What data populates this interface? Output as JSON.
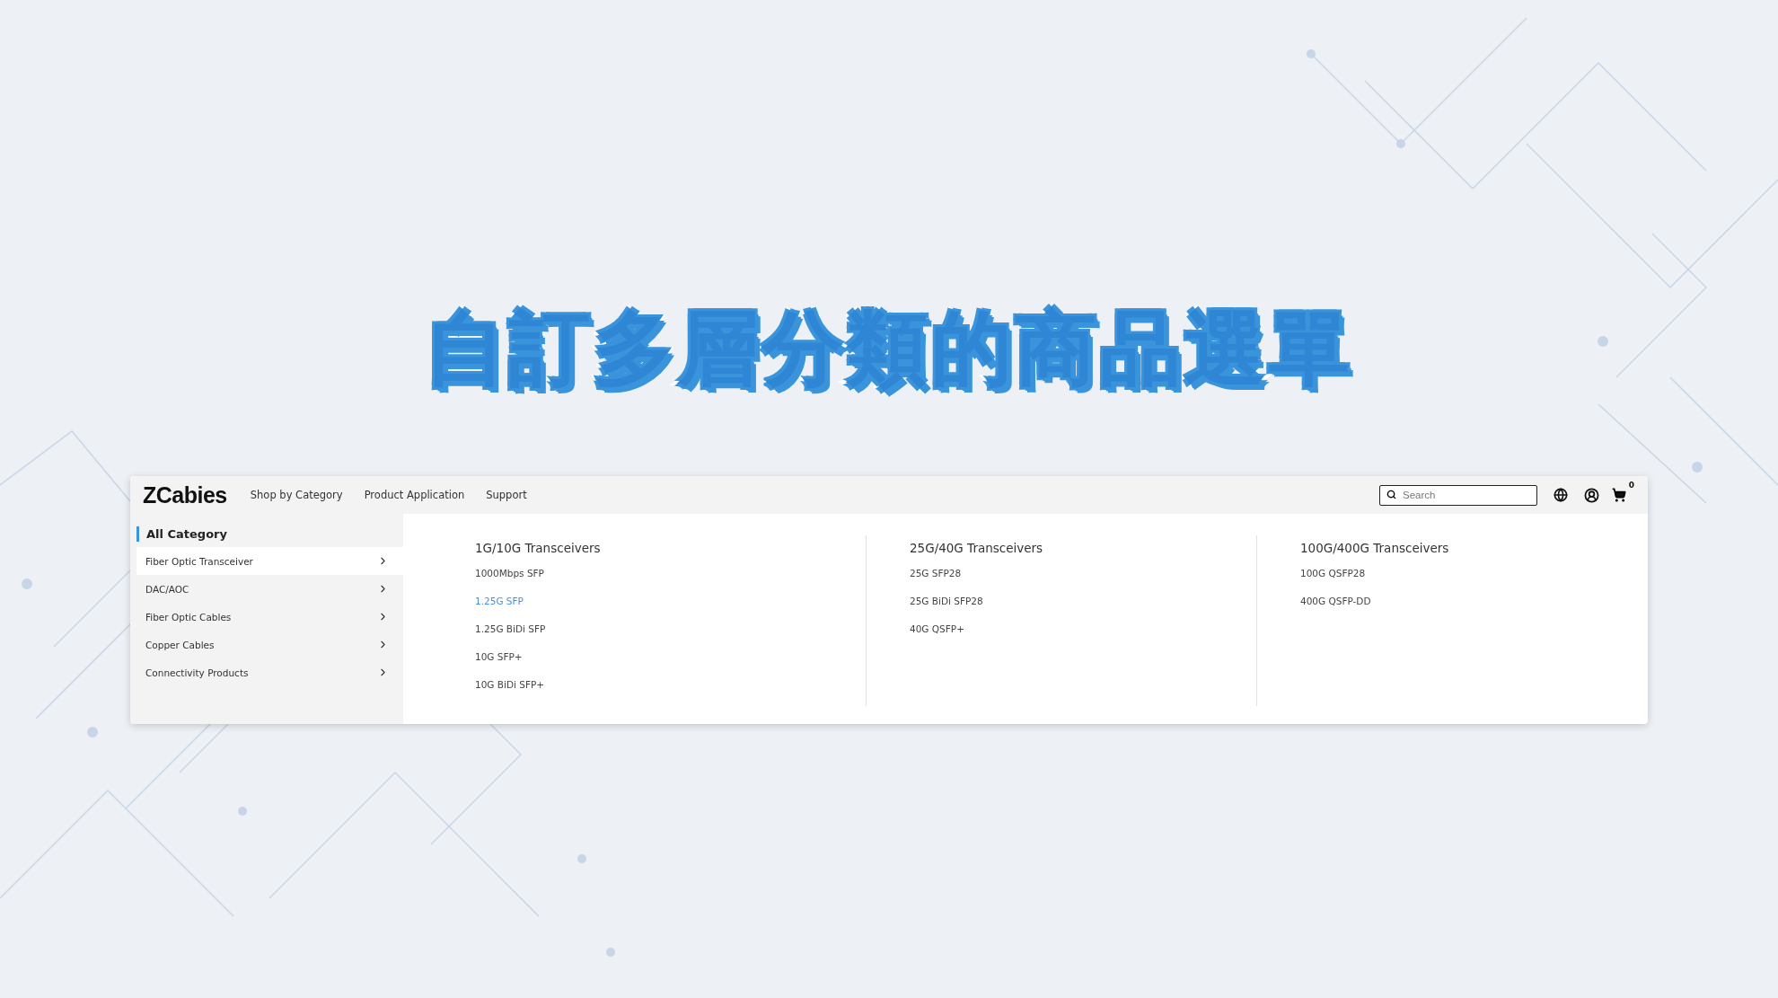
{
  "headline": "自訂多層分類的商品選單",
  "header": {
    "logo": "ZCabies",
    "nav": [
      {
        "label": "Shop by Category"
      },
      {
        "label": "Product Application"
      },
      {
        "label": "Support"
      }
    ],
    "search": {
      "placeholder": "Search"
    },
    "cart_count": "0"
  },
  "sidebar": {
    "title": "All Category",
    "items": [
      {
        "label": "Fiber Optic Transceiver",
        "selected": true
      },
      {
        "label": "DAC/AOC",
        "selected": false
      },
      {
        "label": "Fiber Optic Cables",
        "selected": false
      },
      {
        "label": "Copper Cables",
        "selected": false
      },
      {
        "label": "Connectivity Products",
        "selected": false
      }
    ]
  },
  "columns": [
    {
      "heading": "1G/10G Transceivers",
      "links": [
        {
          "label": "1000Mbps SFP",
          "highlighted": false
        },
        {
          "label": "1.25G SFP",
          "highlighted": true
        },
        {
          "label": "1.25G BiDi SFP",
          "highlighted": false
        },
        {
          "label": "10G SFP+",
          "highlighted": false
        },
        {
          "label": "10G BiDi SFP+",
          "highlighted": false
        }
      ]
    },
    {
      "heading": "25G/40G Transceivers",
      "links": [
        {
          "label": "25G SFP28",
          "highlighted": false
        },
        {
          "label": "25G BiDi SFP28",
          "highlighted": false
        },
        {
          "label": "40G QSFP+",
          "highlighted": false
        }
      ]
    },
    {
      "heading": "100G/400G Transceivers",
      "links": [
        {
          "label": "100G QSFP28",
          "highlighted": false
        },
        {
          "label": "400G QSFP-DD",
          "highlighted": false
        }
      ]
    }
  ]
}
